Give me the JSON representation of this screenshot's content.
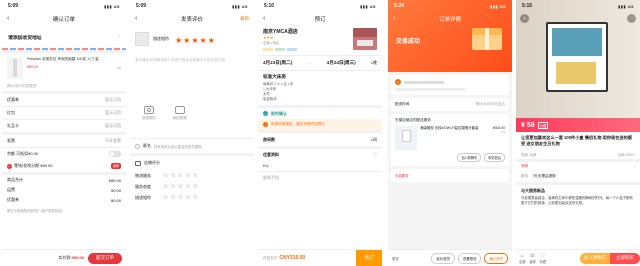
{
  "status": {
    "time_a": "5:09",
    "time_b": "5:10",
    "time_c": "5:24",
    "time_d": "5:15",
    "signal": "4G"
  },
  "p1": {
    "title": "确认订单",
    "address_prompt": "请添加收货地址",
    "product_desc": "Freeplus 芙丽芳丝 净润洗面霜 100克 入门 量",
    "product_price": "¥89.00",
    "product_qty": "x1",
    "product_note": "预计3月23日前发货",
    "rows": [
      {
        "label": "优惠券",
        "value": "暂无可用"
      },
      {
        "label": "红包",
        "value": "暂无可用"
      },
      {
        "label": "礼品卡",
        "value": "暂无可用"
      }
    ],
    "invoice_label": "发票",
    "invoice_value": "不开发票",
    "balance_label": "余额 可抵扣¥0.00",
    "cod_text": "零钱/花呗分期 ¥89.00",
    "summary": [
      {
        "label": "商品合计",
        "value": "¥89.00"
      },
      {
        "label": "运费",
        "value": "¥0.00"
      },
      {
        "label": "优惠券",
        "value": "-¥0.00"
      }
    ],
    "agree_text": "提交订单则表示您同意《用户服务协议》",
    "pay_label": "实付款:",
    "pay_amount": "¥89.00",
    "submit": "提交订单"
  },
  "p2": {
    "title": "发表评价",
    "publish": "发布",
    "shop_name": "描述相符",
    "placeholder": "宝贝满足你的期待吗？说说它的优点和美中不足的地方吧",
    "photo_label": "添加图片",
    "video_label": "添加视频",
    "anon_label": "匿名",
    "anon_hint": "你写的评价会以匿名的形式展现",
    "store_label": "店铺评分",
    "store_rows": [
      "物流服务",
      "服务态度",
      "描述相符"
    ]
  },
  "p3": {
    "title": "预订",
    "hotel_name": "南京YMCA酒店",
    "hotel_tags": "店铺 | 地址",
    "checkin": "4月23日(周二)",
    "checkout": "4月24日(周三)",
    "nights": "1晚",
    "room_title": "标准大床房",
    "room_lines": [
      "每晚供 1 人入住 | 床",
      "1 大床房",
      "无早",
      "免费取消"
    ],
    "notice1": "即时确认",
    "notice2": "房源非常紧张，建议尽快完成预订",
    "rooms_label": "房间数",
    "rooms_value": "1间",
    "guest_label": "住客资料",
    "guest_name": "KU",
    "phone_label": "联系手机",
    "total_label": "在线支付",
    "total_amount": "CNY316.00",
    "submit": "预订"
  },
  "p4": {
    "title": "订单详情",
    "status": "交易成功",
    "store_row": "天猫自营店的配送服务",
    "ship_label": "配送时间",
    "ship_value": "预计04月24日送达",
    "product_name": "海康威视 无线4G/Wi-Fi监控摄像头套装",
    "product_price": "¥304.00",
    "product_qty": "x1",
    "btn_cart": "加入购物车",
    "btn_refund": "申请售后",
    "btn_more": "更多",
    "logistics": "天猫服务",
    "actions": [
      "延长收货",
      "查看物流",
      "确认收货"
    ]
  },
  "p5": {
    "price": "¥ 59",
    "price_tag": "价格",
    "title": "让您更加喜欢这么一套 100件小盒 情侣礼物 用你现在送的感受 送女朋友生日礼物",
    "shipping": "快递: 包邮",
    "sales": "月销 1000+",
    "coupon": "领券",
    "service_label": "服务",
    "service_text": "7天无理由退换",
    "detail_title": "与大图男新品",
    "detail_text": "乌克丽男装组合，装满你生命中那些温暖的瞬间的时光。每一个小盒子都有属于它们的故事，让你更加喜欢这份礼物。",
    "btn_store": "店铺",
    "btn_service": "客服",
    "btn_fav": "收藏",
    "btn_cart": "加入购物车",
    "btn_buy": "立即购买"
  },
  "colors": {
    "tmall_red": "#e4393c",
    "taobao_orange": "#ff5000",
    "fliggy": "#ff9a00"
  }
}
